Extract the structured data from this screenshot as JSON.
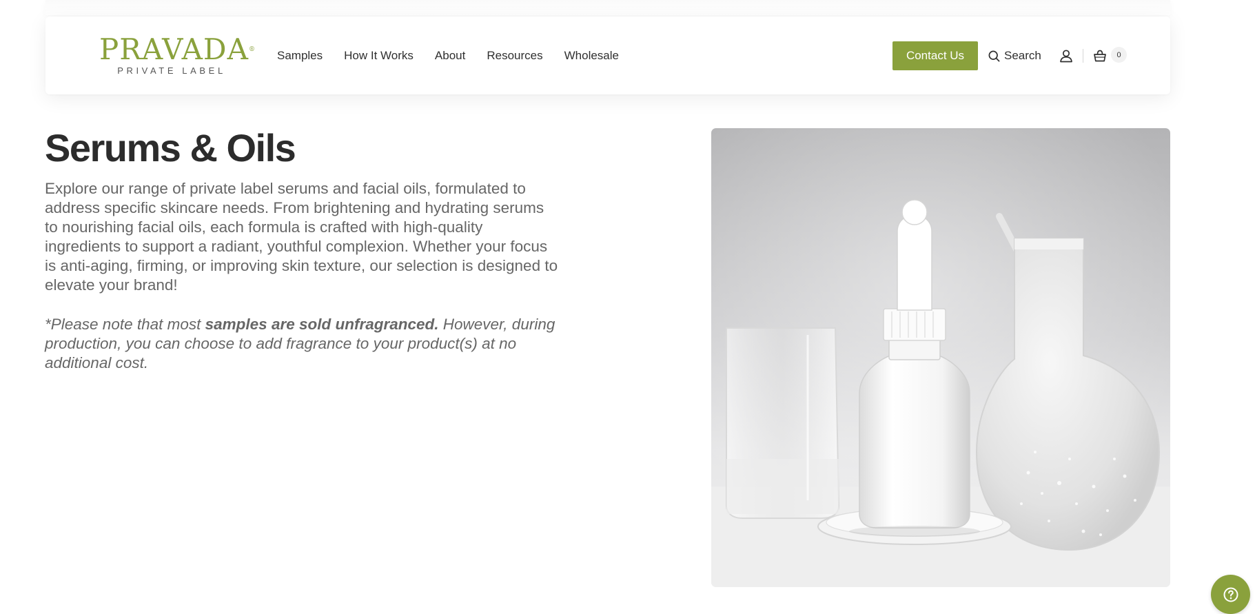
{
  "brand": {
    "name": "PRAVADA",
    "registered_mark": "®",
    "tagline": "PRIVATE LABEL",
    "color": "#8aa13c"
  },
  "nav": {
    "items": [
      {
        "label": "Samples"
      },
      {
        "label": "How It Works"
      },
      {
        "label": "About"
      },
      {
        "label": "Resources"
      },
      {
        "label": "Wholesale"
      }
    ]
  },
  "header_actions": {
    "contact_label": "Contact Us",
    "search_label": "Search",
    "search_icon": "search-icon",
    "account_icon": "user-icon",
    "cart_icon": "basket-icon",
    "cart_count": "0"
  },
  "main": {
    "title": "Serums & Oils",
    "description": "Explore our range of private label serums and facial oils, formulated to address specific skincare needs. From brightening and hydrating serums to nourishing facial oils, each formula is crafted with high-quality ingredients to support a radiant, youthful complexion. Whether your focus is anti-aging, firming, or improving skin texture, our selection is designed to elevate your brand!",
    "note_prefix": "*Please note that most ",
    "note_bold": "samples are sold unfragranced.",
    "note_suffix": " However, during production, you can choose to add fragrance to your product(s) at no additional cost."
  },
  "help": {
    "icon": "help-question-icon"
  }
}
